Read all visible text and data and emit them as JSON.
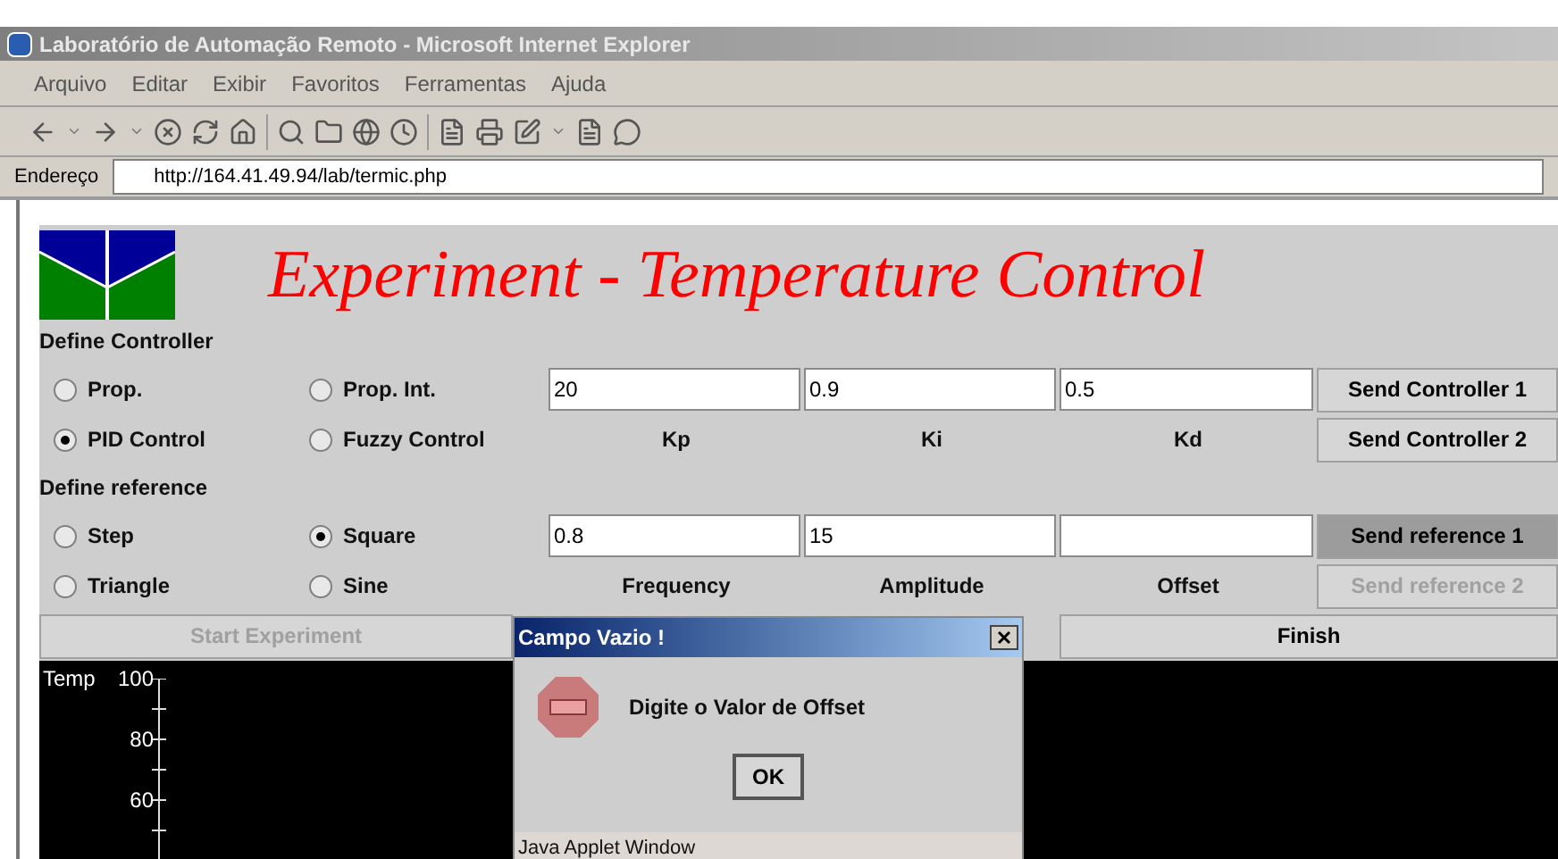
{
  "window": {
    "title": "Laboratório de Automação Remoto - Microsoft Internet Explorer"
  },
  "menu": [
    "Arquivo",
    "Editar",
    "Exibir",
    "Favoritos",
    "Ferramentas",
    "Ajuda"
  ],
  "address_bar": {
    "label": "Endereço",
    "value": "http://164.41.49.94/lab/termic.php"
  },
  "applet": {
    "heading": "Experiment - Temperature Control",
    "controller": {
      "section_label": "Define Controller",
      "options": [
        {
          "label": "Prop.",
          "selected": false
        },
        {
          "label": "Prop. Int.",
          "selected": false
        },
        {
          "label": "PID Control",
          "selected": true
        },
        {
          "label": "Fuzzy Control",
          "selected": false
        }
      ],
      "fields": [
        {
          "value": "20",
          "label": "Kp"
        },
        {
          "value": "0.9",
          "label": "Ki"
        },
        {
          "value": "0.5",
          "label": "Kd"
        }
      ],
      "buttons": [
        {
          "label": "Send Controller 1",
          "pressed": false,
          "disabled": false
        },
        {
          "label": "Send Controller 2",
          "pressed": false,
          "disabled": false
        }
      ]
    },
    "reference": {
      "section_label": "Define reference",
      "options": [
        {
          "label": "Step",
          "selected": false
        },
        {
          "label": "Square",
          "selected": true
        },
        {
          "label": "Triangle",
          "selected": false
        },
        {
          "label": "Sine",
          "selected": false
        }
      ],
      "fields": [
        {
          "value": "0.8",
          "label": "Frequency"
        },
        {
          "value": "15",
          "label": "Amplitude"
        },
        {
          "label": "Offset"
        }
      ],
      "buttons": [
        {
          "label": "Send reference 1",
          "pressed": true,
          "disabled": false
        },
        {
          "label": "Send reference 2",
          "pressed": false,
          "disabled": true
        }
      ]
    },
    "actions": [
      {
        "label": "Start Experiment",
        "disabled": true
      },
      {
        "label": "Finish",
        "disabled": false
      }
    ],
    "plot": {
      "axis_label": "Temp",
      "ticks": [
        "100",
        "80",
        "60"
      ]
    }
  },
  "dialog": {
    "title": "Campo Vazio !",
    "message": "Digite o Valor de Offset",
    "button": "OK",
    "footer": "Java Applet Window"
  }
}
